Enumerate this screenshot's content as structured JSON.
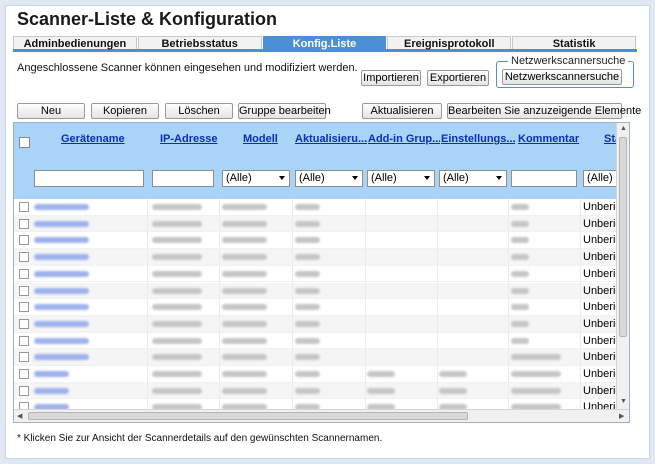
{
  "title": "Scanner-Liste & Konfiguration",
  "tabs": [
    {
      "label": "Adminbedienungen",
      "active": false
    },
    {
      "label": "Betriebsstatus",
      "active": false
    },
    {
      "label": "Konfig.Liste",
      "active": true
    },
    {
      "label": "Ereignisprotokoll",
      "active": false
    },
    {
      "label": "Statistik",
      "active": false
    }
  ],
  "description": "Angeschlossene Scanner können eingesehen und modifiziert werden.",
  "buttons": {
    "import": "Importieren",
    "export": "Exportieren",
    "network_group_legend": "Netzwerkscannersuche",
    "network_search": "Netzwerkscannersuche",
    "new": "Neu",
    "copy": "Kopieren",
    "delete": "Löschen",
    "edit_group": "Gruppe bearbeiten",
    "refresh": "Aktualisieren",
    "edit_columns": "Bearbeiten Sie anzuzeigende Elemente"
  },
  "table": {
    "columns": [
      "Gerätename",
      "IP-Adresse",
      "Modell",
      "Aktualisieru...",
      "Add-in Grup...",
      "Einstellungs...",
      "Kommentar",
      "Status"
    ],
    "filters": {
      "model": "(Alle)",
      "update": "(Alle)",
      "addin": "(Alle)",
      "settings": "(Alle)",
      "status": "(Alle)"
    },
    "status_value": "Unberich",
    "row_count": 13
  },
  "footnote": "* Klicken Sie zur Ansicht der Scannerdetails auf den gewünschten Scannernamen.",
  "colors": {
    "accent": "#4d8fd6",
    "header_bg": "#a9d4f7",
    "link": "#0b2fb0",
    "page_bg": "#dfe8f3"
  }
}
